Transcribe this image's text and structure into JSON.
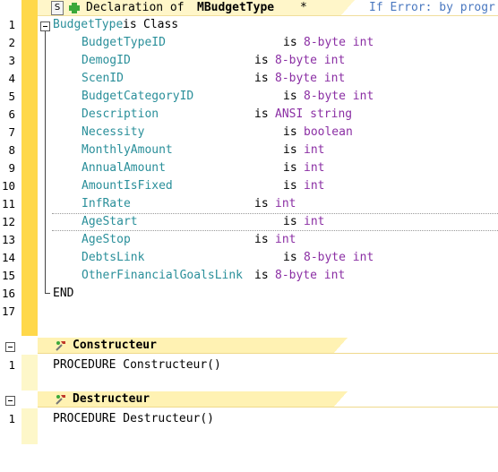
{
  "header": {
    "s_badge": "S",
    "declaration_prefix": "Declaration of ",
    "declaration_name": "MBudgetType",
    "modified_marker": "*",
    "error_hint": "If Error: by progr"
  },
  "class_decl": {
    "lines": [
      {
        "num": "1",
        "name": "BudgetType",
        "is": "is",
        "type": "Class"
      },
      {
        "num": "2",
        "name": "BudgetTypeID",
        "is": "is",
        "type": "8-byte int"
      },
      {
        "num": "3",
        "name": "DemogID",
        "is": "is",
        "type": "8-byte int"
      },
      {
        "num": "4",
        "name": "ScenID",
        "is": "is",
        "type": "8-byte int"
      },
      {
        "num": "5",
        "name": "BudgetCategoryID",
        "is": "is",
        "type": "8-byte int"
      },
      {
        "num": "6",
        "name": "Description",
        "is": "is",
        "type": "ANSI string"
      },
      {
        "num": "7",
        "name": "Necessity",
        "is": "is",
        "type": "boolean"
      },
      {
        "num": "8",
        "name": "MonthlyAmount",
        "is": "is",
        "type": "int"
      },
      {
        "num": "9",
        "name": "AnnualAmount",
        "is": "is",
        "type": "int"
      },
      {
        "num": "10",
        "name": "AmountIsFixed",
        "is": "is",
        "type": "int"
      },
      {
        "num": "11",
        "name": "InfRate",
        "is": "is",
        "type": "int"
      },
      {
        "num": "12",
        "name": "AgeStart",
        "is": "is",
        "type": "int"
      },
      {
        "num": "13",
        "name": "AgeStop",
        "is": "is",
        "type": "int"
      },
      {
        "num": "14",
        "name": "DebtsLink",
        "is": "is",
        "type": "8-byte int"
      },
      {
        "num": "15",
        "name": "OtherFinancialGoalsLink",
        "is": "is",
        "type": "8-byte int"
      },
      {
        "num": "16",
        "end": "END"
      },
      {
        "num": "17"
      }
    ]
  },
  "constructor": {
    "title": "Constructeur",
    "line_num": "1",
    "code": "PROCEDURE Constructeur()"
  },
  "destructor": {
    "title": "Destructeur",
    "line_num": "1",
    "code": "PROCEDURE Destructeur()"
  },
  "colors": {
    "identifier": "#2a8f9a",
    "type": "#8b2fa4",
    "gutter_active": "#ffd84a",
    "gutter_pale": "#fdf7c9",
    "section_header": "#fff2b3"
  }
}
